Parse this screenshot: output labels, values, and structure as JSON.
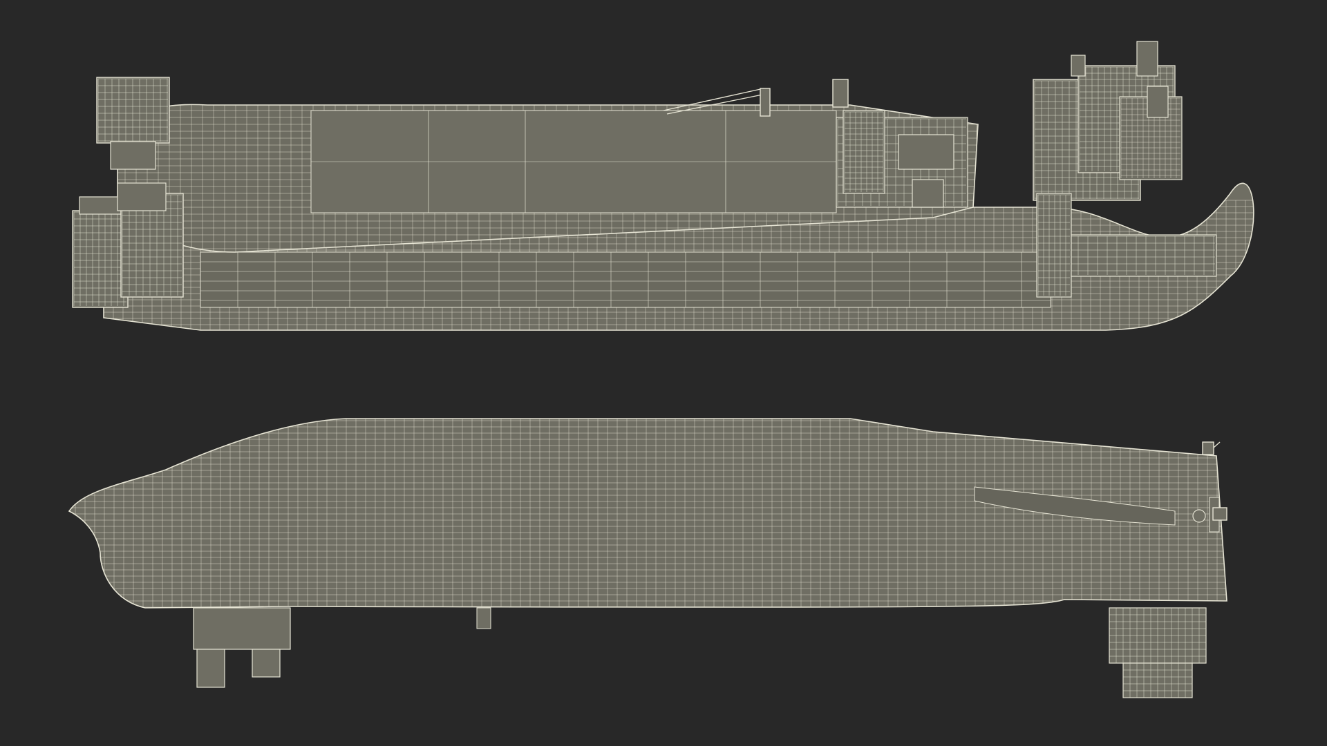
{
  "scene": {
    "background_color": "#282828",
    "hull_color": "#6f6e63",
    "wire_color": "#e6e4d4",
    "deck_shadow_color": "#5e5d53"
  },
  "views": [
    {
      "name": "top-view",
      "description_label": ""
    },
    {
      "name": "bottom-view",
      "description_label": ""
    }
  ]
}
